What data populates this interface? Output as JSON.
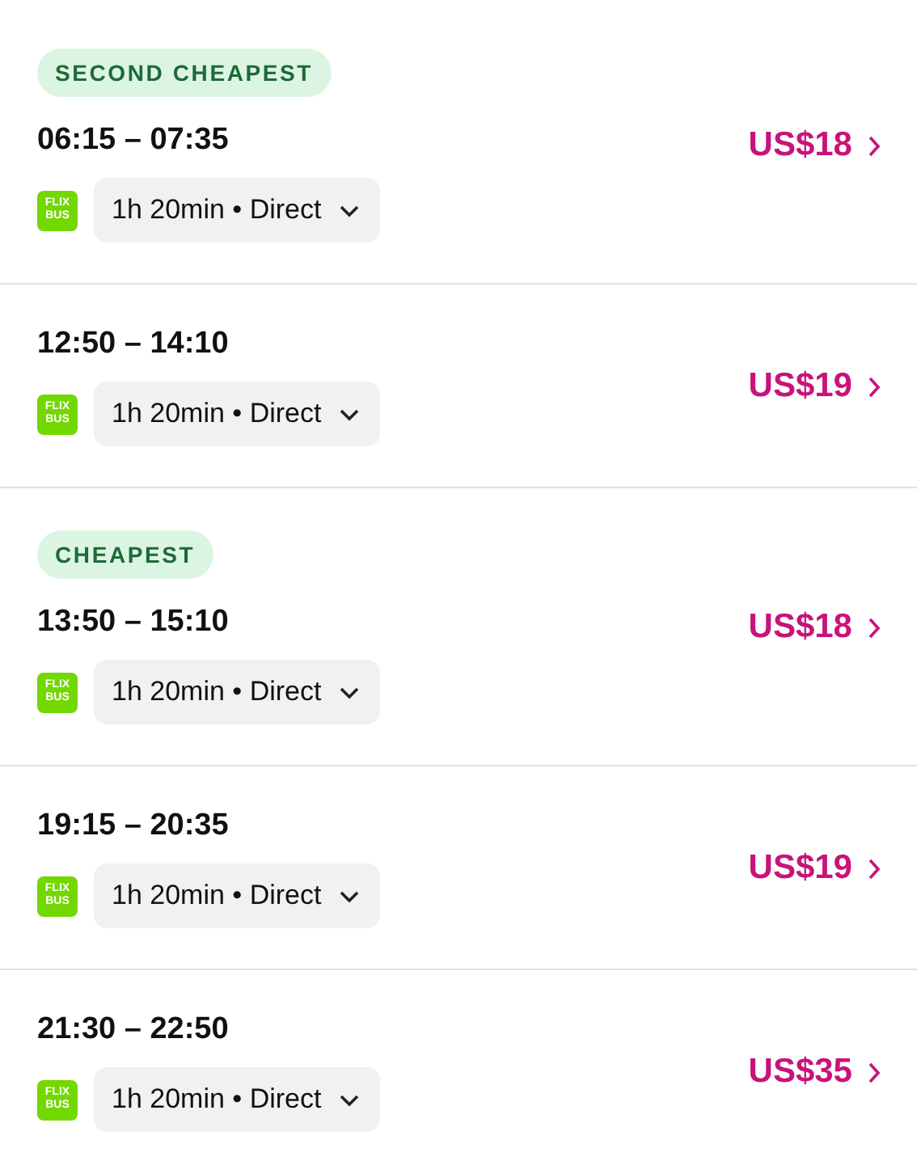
{
  "trips": [
    {
      "badge": "SECOND CHEAPEST",
      "times": "06:15 – 07:35",
      "logo_lines": [
        "FLIX",
        "BUS"
      ],
      "details": "1h 20min • Direct",
      "price": "US$18"
    },
    {
      "times": "12:50 – 14:10",
      "logo_lines": [
        "FLIX",
        "BUS"
      ],
      "details": "1h 20min • Direct",
      "price": "US$19"
    },
    {
      "badge": "CHEAPEST",
      "times": "13:50 – 15:10",
      "logo_lines": [
        "FLIX",
        "BUS"
      ],
      "details": "1h 20min • Direct",
      "price": "US$18"
    },
    {
      "times": "19:15 – 20:35",
      "logo_lines": [
        "FLIX",
        "BUS"
      ],
      "details": "1h 20min • Direct",
      "price": "US$19"
    },
    {
      "times": "21:30 – 22:50",
      "logo_lines": [
        "FLIX",
        "BUS"
      ],
      "details": "1h 20min • Direct",
      "price": "US$35"
    }
  ]
}
